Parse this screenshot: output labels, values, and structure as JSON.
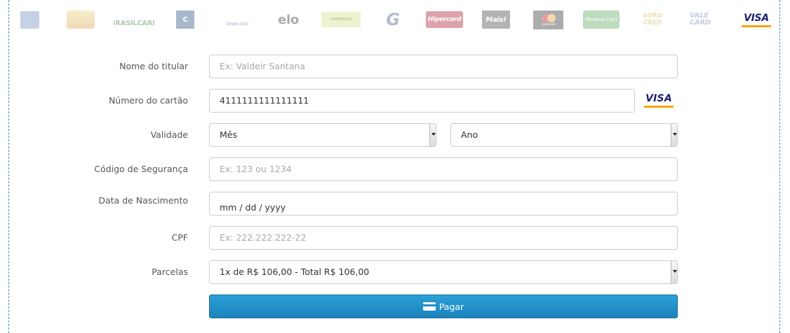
{
  "brands": [
    {
      "name": "American Express",
      "text": "",
      "color": "#5a7fc0"
    },
    {
      "name": "Aura",
      "text": "",
      "color": "#e8c24a"
    },
    {
      "name": "BrasilCard",
      "text": "BRASILCARD",
      "color": "#2e7d32"
    },
    {
      "name": "Cabal",
      "text": "C",
      "color": "#1f4e8c"
    },
    {
      "name": "Diners Club",
      "text": "Diners Club",
      "color": "#0a3a7a"
    },
    {
      "name": "Elo",
      "text": "elo",
      "color": "#333333"
    },
    {
      "name": "Fortbrasil",
      "text": "FORTBRASIL",
      "color": "#b5cc2e"
    },
    {
      "name": "Goodcard",
      "text": "G",
      "color": "#3b5a99"
    },
    {
      "name": "Hipercard",
      "text": "Hipercard",
      "color": "#c8102e"
    },
    {
      "name": "Mais",
      "text": "Mais!",
      "color": "#333333"
    },
    {
      "name": "Mastercard",
      "text": "mastercard",
      "color": "#222222"
    },
    {
      "name": "Personal Card",
      "text": "Personal Card",
      "color": "#4caf50"
    },
    {
      "name": "Sorocred",
      "text": "SORO CRED",
      "color": "#e0a82e"
    },
    {
      "name": "Vale Card",
      "text": "VALE CARD",
      "color": "#6a7fc0"
    },
    {
      "name": "Visa",
      "text": "VISA",
      "color": "#1a1f71"
    }
  ],
  "form": {
    "holder_label": "Nome do titular",
    "holder_placeholder": "Ex: Valdeir Santana",
    "number_label": "Número do cartão",
    "number_value": "4111111111111111",
    "detected_brand": "VISA",
    "validity_label": "Validade",
    "month_value": "Mês",
    "year_value": "Ano",
    "cvv_label": "Código de Segurança",
    "cvv_placeholder": "Ex: 123 ou 1234",
    "birth_label": "Data de Nascimento",
    "birth_value": "mm / dd / yyyy",
    "cpf_label": "CPF",
    "cpf_placeholder": "Ex: 222.222.222-22",
    "installments_label": "Parcelas",
    "installments_value": "1x de R$ 106,00 - Total R$ 106,00",
    "pay_label": "Pagar"
  },
  "colors": {
    "accent": "#1f8bc6",
    "frame_border": "#3a8fb7",
    "visa_blue": "#1a1f71",
    "visa_gold": "#f7a600"
  }
}
